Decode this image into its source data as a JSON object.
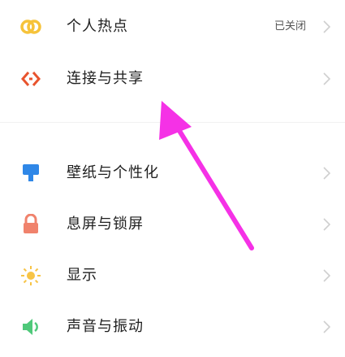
{
  "colors": {
    "accent_arrow": "#f531e6",
    "icon_yellow": "#f6c33a",
    "icon_red": "#e8542e",
    "icon_blue": "#2f87e7",
    "icon_salmon": "#f0826c",
    "icon_sun": "#f7c446",
    "icon_green": "#4fc97a",
    "chevron": "#cfcfcf"
  },
  "settings": {
    "items": [
      {
        "label": "个人热点",
        "status": "已关闭",
        "icon": "hotspot-icon"
      },
      {
        "label": "连接与共享",
        "icon": "connection-share-icon"
      },
      {
        "label": "壁纸与个性化",
        "icon": "wallpaper-personalize-icon"
      },
      {
        "label": "息屏与锁屏",
        "icon": "lock-screen-icon"
      },
      {
        "label": "显示",
        "icon": "display-brightness-icon"
      },
      {
        "label": "声音与振动",
        "icon": "sound-vibration-icon"
      }
    ]
  },
  "annotation": {
    "icon": "pointer-arrow"
  }
}
